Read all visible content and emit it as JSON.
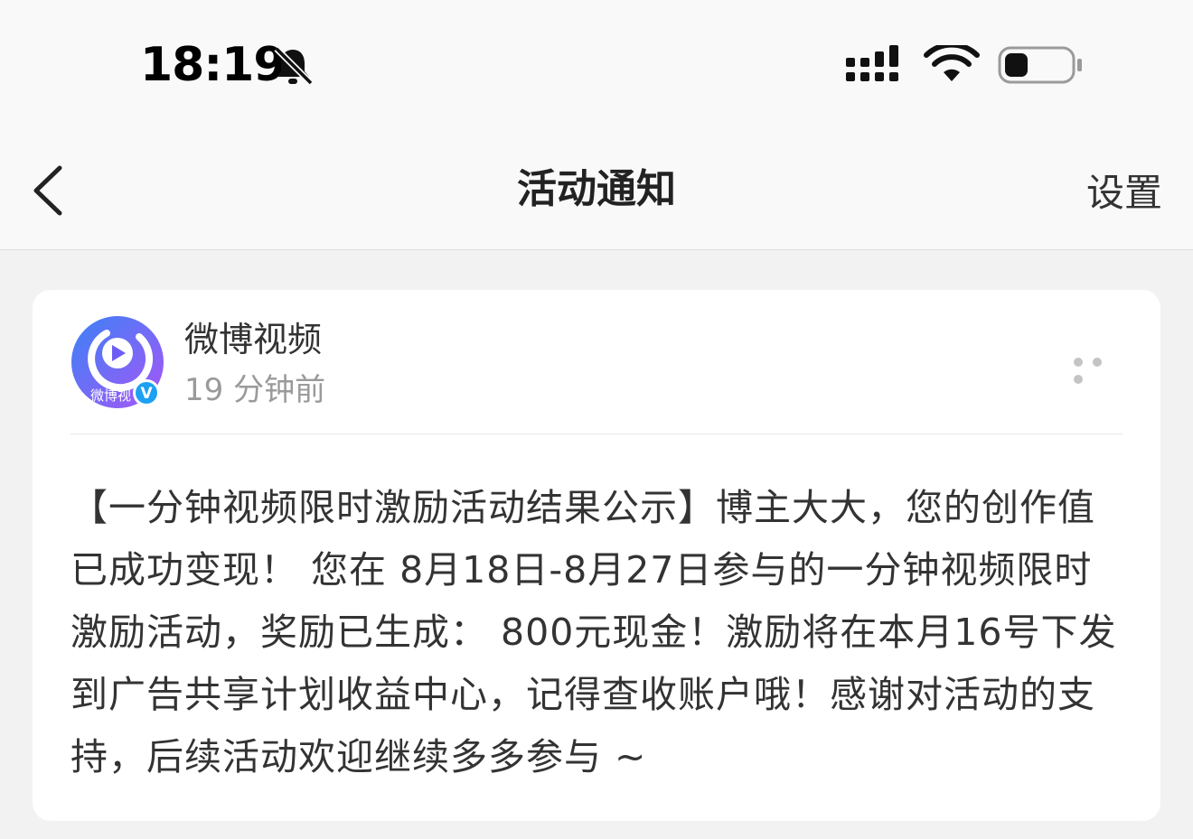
{
  "status_bar": {
    "time": "18:19",
    "icons": [
      "bell-slash-icon",
      "cellular-signal-icon",
      "wifi-icon",
      "battery-icon"
    ],
    "battery_level": 0.25
  },
  "nav": {
    "back_icon": "chevron-left-icon",
    "title": "活动通知",
    "settings_label": "设置"
  },
  "notification": {
    "sender_name": "微博视频",
    "sender_avatar_text": "微博视",
    "verified_badge": "V",
    "timestamp": "19 分钟前",
    "more_icon": "more-dots-icon",
    "message": "【一分钟视频限时激励活动结果公示】博主大大，您的创作值已成功变现！ 您在 8月18日-8月27日参与的一分钟视频限时激励活动，奖励已生成： 800元现金！激励将在本月16号下发到广告共享计划收益中心，记得查收账户哦！感谢对活动的支持，后续活动欢迎继续多多参与 ~"
  },
  "colors": {
    "background": "#f2f2f2",
    "card": "#ffffff",
    "text_primary": "#333333",
    "text_secondary": "#9a9a9a",
    "avatar_gradient_start": "#3b82f6",
    "avatar_gradient_end": "#a855f7",
    "verified_blue": "#1da1f2"
  }
}
